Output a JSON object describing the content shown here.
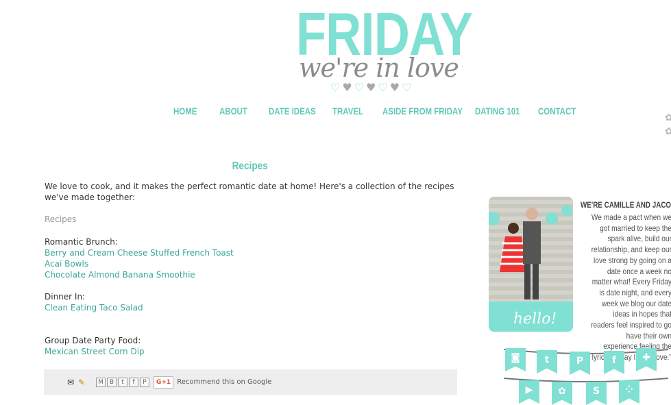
{
  "header": {
    "logo_main": "FRIDAY",
    "logo_script": "we're in love",
    "hearts": [
      "teal",
      "gray",
      "teal",
      "gray",
      "teal",
      "gray",
      "teal"
    ]
  },
  "nav": [
    "HOME",
    "ABOUT",
    "DATE IDEAS",
    "TRAVEL",
    "ASIDE FROM FRIDAY",
    "DATING 101",
    "CONTACT"
  ],
  "post": {
    "title": "Recipes",
    "intro": "We love to cook, and it makes the perfect romantic date at home! Here's a collection of the recipes we've made together:",
    "label": "Recipes",
    "sections": [
      {
        "heading": "Romantic Brunch:",
        "links": [
          "Berry and Cream Cheese Stuffed French Toast",
          "Acai Bowls",
          "Chocolate Almond Banana Smoothie"
        ]
      },
      {
        "heading": "Dinner In:",
        "links": [
          "Clean Eating Taco Salad"
        ]
      },
      {
        "heading": "Group Date Party Food:",
        "links": [
          "Mexican Street Corn Dip"
        ]
      }
    ]
  },
  "share": {
    "gplus": "G+1",
    "recommend": "Recommend this on Google"
  },
  "sidebar": {
    "photo_caption": "hello!",
    "bio_title": "WE'RE CAMILLE AND JACOB!",
    "bio_text": "We made a pact when we got married to keep the spark alive, build our relationship, and keep our love strong by going on a date once a week no matter what! Every Friday is date night, and every week we blog our date ideas in hopes that readers feel inspired to go have their own experience feeling the lyrics \"Friday I'm in Love.\"",
    "social_icons": [
      "instagram-icon",
      "twitter-icon",
      "pinterest-icon",
      "facebook-icon",
      "bloglovin-icon",
      "youtube-icon",
      "tumblr-icon",
      "stumbleupon-icon",
      "more-icon"
    ],
    "accent": "#7fe0d3"
  }
}
